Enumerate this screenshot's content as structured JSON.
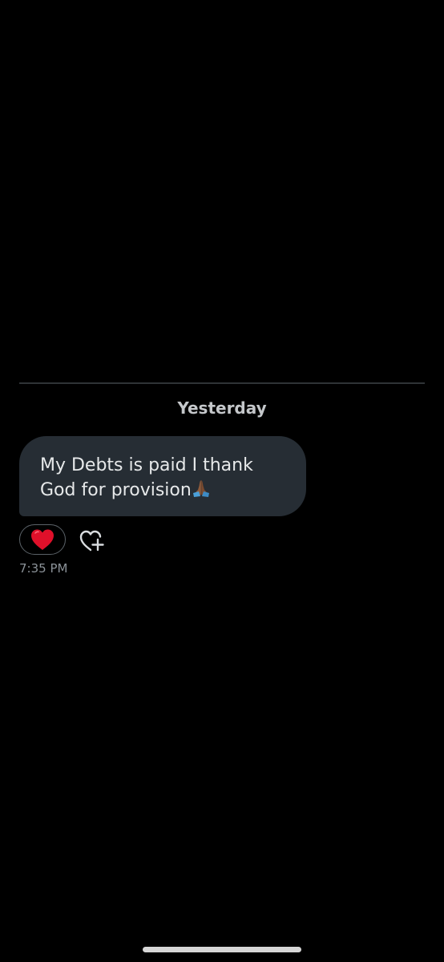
{
  "conversation": {
    "date_separator": "Yesterday",
    "message": {
      "text": "My Debts is paid I thank God for provision",
      "emoji_icon": "folded-hands-icon",
      "reaction_icon": "red-heart-icon",
      "timestamp": "7:35 PM"
    },
    "add_reaction_icon": "heart-plus-icon"
  },
  "colors": {
    "background": "#000000",
    "bubble": "#262d34",
    "divider": "#2f3336",
    "timestamp": "#8b9298",
    "heart": "#e0102a"
  }
}
